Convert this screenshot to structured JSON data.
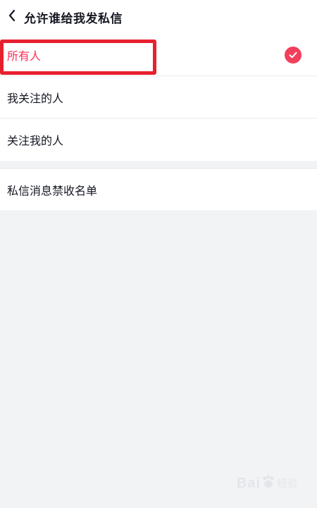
{
  "header": {
    "back_icon": "chevron-left-icon",
    "title": "允许谁给我发私信"
  },
  "options": [
    {
      "label": "所有人",
      "selected": true
    },
    {
      "label": "我关注的人",
      "selected": false
    },
    {
      "label": "关注我的人",
      "selected": false
    }
  ],
  "blocklist": {
    "label": "私信消息禁收名单"
  },
  "watermark": {
    "brand": "Bai",
    "suffix": "经验"
  },
  "colors": {
    "accent": "#fe2c55",
    "check_bg": "#f2405c",
    "highlight": "#e8202e",
    "background": "#f1f3f5"
  }
}
